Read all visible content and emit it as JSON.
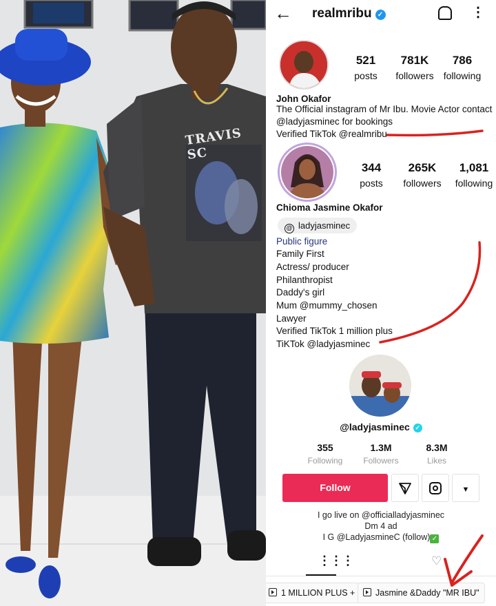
{
  "instagram_1": {
    "username": "realmribu",
    "stats": [
      {
        "value": "521",
        "label": "posts"
      },
      {
        "value": "781K",
        "label": "followers"
      },
      {
        "value": "786",
        "label": "following"
      }
    ],
    "name": "John Okafor",
    "bio": [
      "The Official instagram of Mr Ibu. Movie Actor contact",
      "@ladyjasminec for bookings",
      "Verified TikTok @realmribu"
    ]
  },
  "instagram_2": {
    "stats": [
      {
        "value": "344",
        "label": "posts"
      },
      {
        "value": "265K",
        "label": "followers"
      },
      {
        "value": "1,081",
        "label": "following"
      }
    ],
    "name": "Chioma Jasmine Okafor",
    "threads_handle": "ladyjasminec",
    "category": "Public figure",
    "bio": [
      "Family First",
      "Actress/ producer",
      "Philanthropist",
      "Daddy's girl",
      "Mum @mummy_chosen",
      "Lawyer",
      "Verified TikTok 1 million plus",
      "TiKTok @ladyjasminec"
    ]
  },
  "tiktok": {
    "username": "@ladyjasminec",
    "stats": [
      {
        "value": "355",
        "label": "Following"
      },
      {
        "value": "1.3M",
        "label": "Followers"
      },
      {
        "value": "8.3M",
        "label": "Likes"
      }
    ],
    "follow_label": "Follow",
    "bio": [
      "I go live on @officialladyjasminec",
      "Dm  4 ad",
      "I G @LadyjasmineC (follow)"
    ],
    "playlists": [
      "1 MILLION PLUS +",
      "Jasmine &Daddy \"MR IBU\""
    ]
  },
  "photo": {
    "shirt_text": "TRAVIS SC"
  },
  "colors": {
    "follow_red": "#ea2b55",
    "verified_blue": "#1e96f0",
    "annotation_red": "#d8231f"
  }
}
